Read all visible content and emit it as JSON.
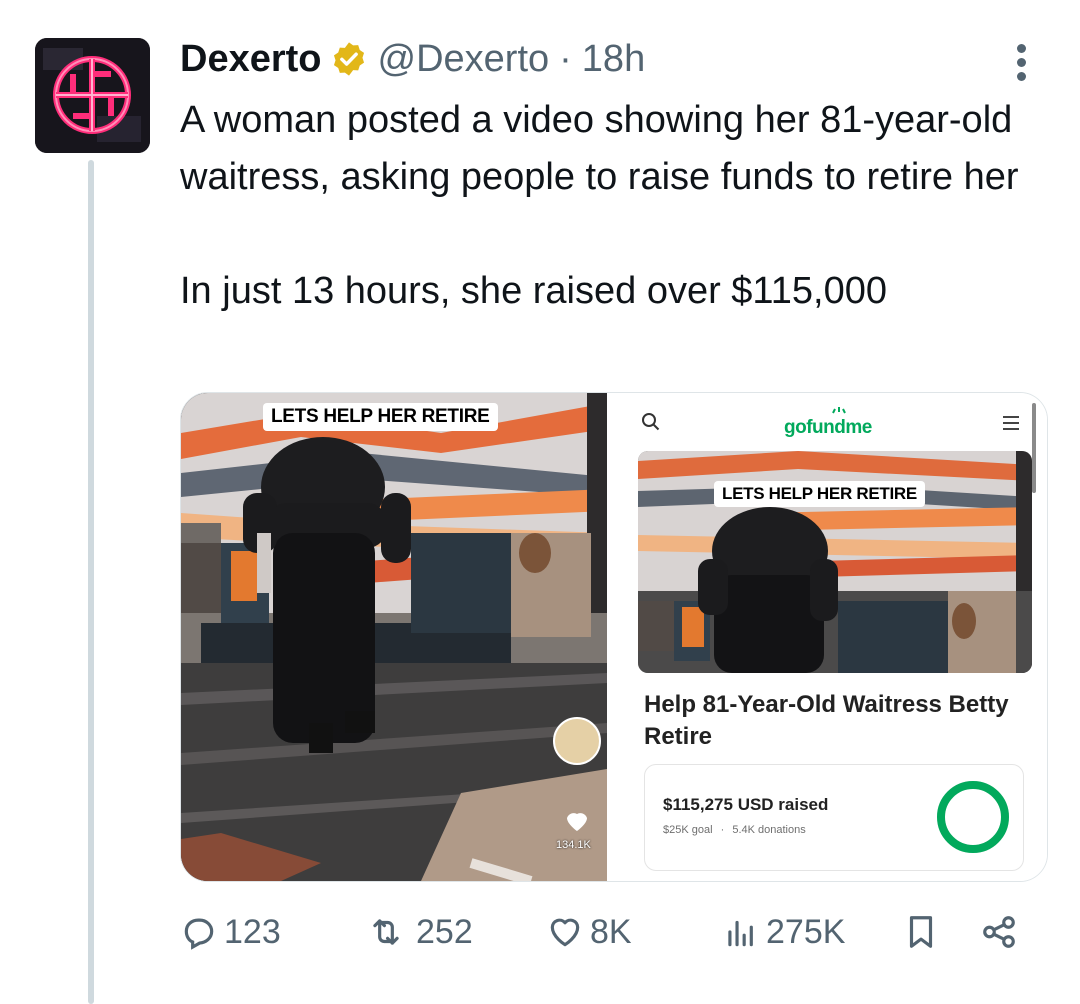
{
  "tweet": {
    "author_name": "Dexerto",
    "handle": "@Dexerto",
    "separator": "·",
    "time": "18h",
    "text_lines": [
      "A woman posted a video showing her 81-year-old waitress, asking people to raise funds to retire her",
      "In just 13 hours, she raised over $115,000"
    ]
  },
  "media": {
    "left": {
      "caption": "LETS HELP HER RETIRE",
      "like_count": "134.1K"
    },
    "right": {
      "logo": "gofundme",
      "caption": "LETS HELP HER RETIRE",
      "title": "Help 81-Year-Old Waitress Betty Retire",
      "raised": "$115,275 USD raised",
      "goal": "$25K goal",
      "dot": "·",
      "donations": "5.4K donations",
      "progress_fraction": 1.0
    }
  },
  "actions": {
    "replies": "123",
    "reposts": "252",
    "likes": "8K",
    "views": "275K"
  },
  "icons": {
    "verified": "verified-badge-icon",
    "reply": "reply-icon",
    "repost": "repost-icon",
    "like": "heart-icon",
    "views": "views-chart-icon",
    "bookmark": "bookmark-icon",
    "share": "share-icon",
    "more": "more-dots-icon"
  },
  "colors": {
    "verified_gold": "#e2b719",
    "secondary_text": "#536471",
    "gofundme_green": "#02a95c",
    "avatar_neon": "#ff2d7a"
  }
}
